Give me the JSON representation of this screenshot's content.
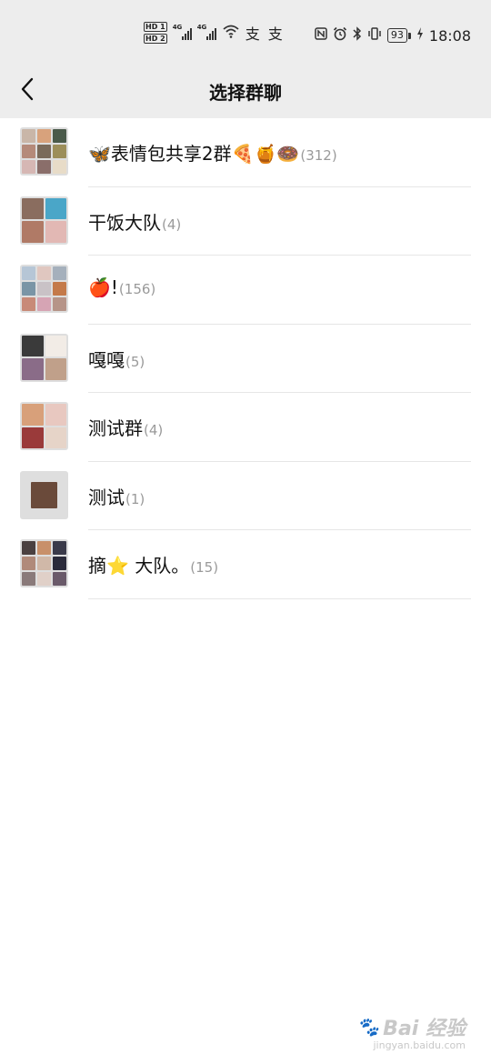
{
  "status_bar": {
    "hd1": "HD 1",
    "hd2": "HD 2",
    "net1": "4G",
    "net2": "4G",
    "extra_icons": "支 支",
    "battery": "93",
    "time": "18:08"
  },
  "nav": {
    "back_icon": "chevron-left-icon",
    "title": "选择群聊"
  },
  "groups": [
    {
      "name": "🦋表情包共享2群🍕🍯🍩",
      "count": "(312)",
      "avatar_layout": "3x3",
      "avatar_colors": [
        "#c9b6a8",
        "#d8a27c",
        "#4a5a4a",
        "#b58a7a",
        "#7a6a5a",
        "#9c8e5a",
        "#d6b7b4",
        "#8a6e6a",
        "#e8dcc8"
      ]
    },
    {
      "name": "干饭大队",
      "count": "(4)",
      "avatar_layout": "2x2",
      "avatar_colors": [
        "#8a6d5f",
        "#4aa6c8",
        "#b07a66",
        "#e2b8b4"
      ]
    },
    {
      "name": "🍎!",
      "count": " (156)",
      "avatar_layout": "3x3",
      "avatar_colors": [
        "#b6c6d6",
        "#e0c7c0",
        "#a5b0bc",
        "#7a95a6",
        "#c9c2c6",
        "#c47a4a",
        "#c88a78",
        "#d6a4b4",
        "#b69488"
      ]
    },
    {
      "name": "嘎嘎",
      "count": "(5)",
      "avatar_layout": "2x2",
      "avatar_colors": [
        "#3a3a3a",
        "#f2ece6",
        "#8a6c88",
        "#c0a08a"
      ]
    },
    {
      "name": "测试群",
      "count": "(4)",
      "avatar_layout": "2x2",
      "avatar_colors": [
        "#d8a07a",
        "#e8c8c0",
        "#9a3a3a",
        "#e6d4c8"
      ]
    },
    {
      "name": "测试",
      "count": "(1)",
      "avatar_layout": "1x1",
      "avatar_colors": [
        "#6a4a3a"
      ]
    },
    {
      "name": "摘⭐ 大队。",
      "count": " (15)",
      "avatar_layout": "3x3",
      "avatar_colors": [
        "#4a4040",
        "#c8906a",
        "#3a3a4a",
        "#b08a7a",
        "#d0b8a8",
        "#2a2a3a",
        "#8a7a7a",
        "#e0d0c8",
        "#6a5a6a"
      ]
    }
  ],
  "watermark": {
    "logo_text": "Bai 经验",
    "url": "jingyan.baidu.com"
  }
}
